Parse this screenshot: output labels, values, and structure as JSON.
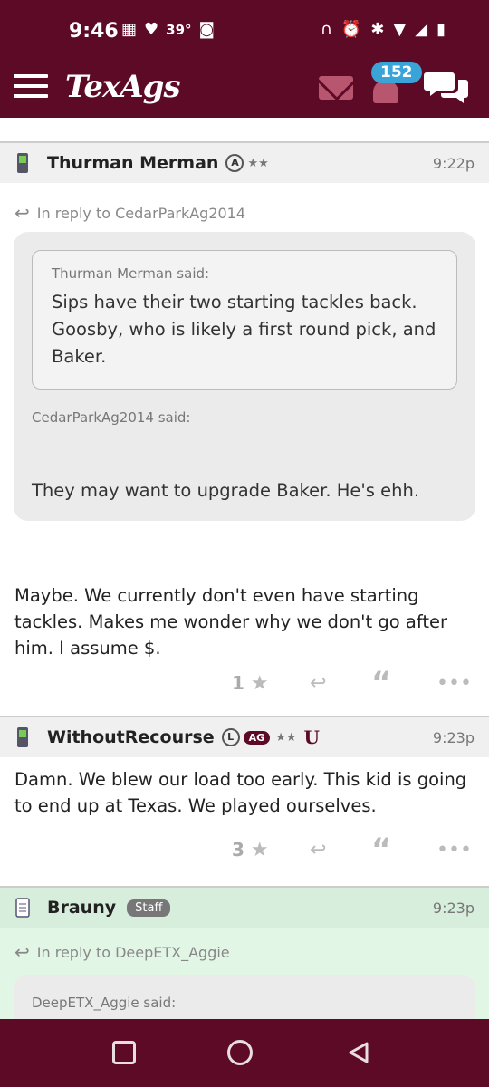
{
  "status_bar": {
    "time": "9:46",
    "temperature": "39°"
  },
  "header": {
    "logo": "TexAgs",
    "notification_count": "152"
  },
  "posts": [
    {
      "author": "Thurman Merman",
      "badges": [
        "A"
      ],
      "time": "9:22p",
      "reply_to": "In reply to CedarParkAg2014",
      "nested_quote_author": "Thurman Merman said:",
      "nested_quote_text": "Sips have their two starting tackles back. Goosby, who is likely a first round pick, and Baker.",
      "quote_author": "CedarParkAg2014 said:",
      "quote_text": "They may want to upgrade Baker. He's ehh.",
      "body": "Maybe. We currently don't even have starting tackles. Makes me wonder why we don't go after him. I assume $.",
      "stars": "1"
    },
    {
      "author": "WithoutRecourse",
      "badges": [
        "L",
        "AG"
      ],
      "time": "9:23p",
      "body": "Damn. We blew our load too early. This kid is going to end up at Texas. We played ourselves.",
      "stars": "3"
    },
    {
      "author": "Brauny",
      "staff_label": "Staff",
      "time": "9:23p",
      "reply_to": "In reply to DeepETX_Aggie",
      "quote_author": "DeepETX_Aggie said:"
    }
  ],
  "colors": {
    "maroon": "#5c0a26",
    "badge_blue": "#3aa3d8",
    "staff_bg": "#d8eedc"
  }
}
